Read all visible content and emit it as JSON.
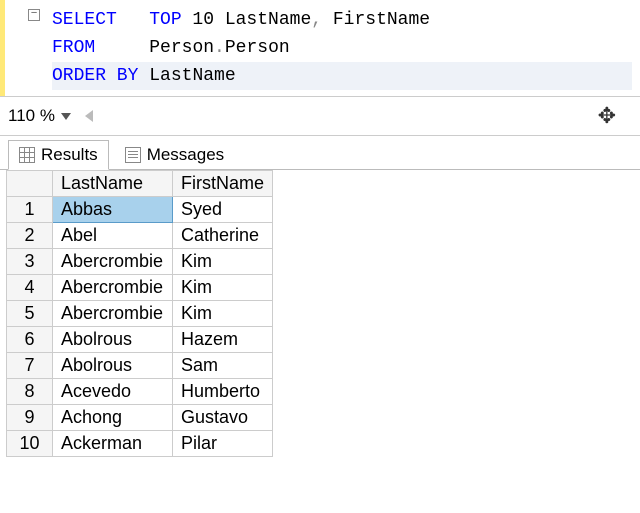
{
  "editor": {
    "collapse_symbol": "−",
    "lines": [
      {
        "kw1": "SELECT",
        "kw2": "TOP",
        "rest": " 10 LastName",
        "punct": ",",
        "rest2": " FirstName"
      },
      {
        "kw1": "FROM",
        "rest": "Person",
        "punct": ".",
        "rest2": "Person"
      },
      {
        "kw1": "ORDER BY",
        "rest": "LastName"
      }
    ]
  },
  "zoom": {
    "value": "110 %"
  },
  "tabs": {
    "results": "Results",
    "messages": "Messages"
  },
  "results": {
    "headers": {
      "col1": "LastName",
      "col2": "FirstName"
    },
    "rows": [
      {
        "n": "1",
        "last": "Abbas",
        "first": "Syed"
      },
      {
        "n": "2",
        "last": "Abel",
        "first": "Catherine"
      },
      {
        "n": "3",
        "last": "Abercrombie",
        "first": "Kim"
      },
      {
        "n": "4",
        "last": "Abercrombie",
        "first": "Kim"
      },
      {
        "n": "5",
        "last": "Abercrombie",
        "first": "Kim"
      },
      {
        "n": "6",
        "last": "Abolrous",
        "first": "Hazem"
      },
      {
        "n": "7",
        "last": "Abolrous",
        "first": "Sam"
      },
      {
        "n": "8",
        "last": "Acevedo",
        "first": "Humberto"
      },
      {
        "n": "9",
        "last": "Achong",
        "first": "Gustavo"
      },
      {
        "n": "10",
        "last": "Ackerman",
        "first": "Pilar"
      }
    ]
  }
}
